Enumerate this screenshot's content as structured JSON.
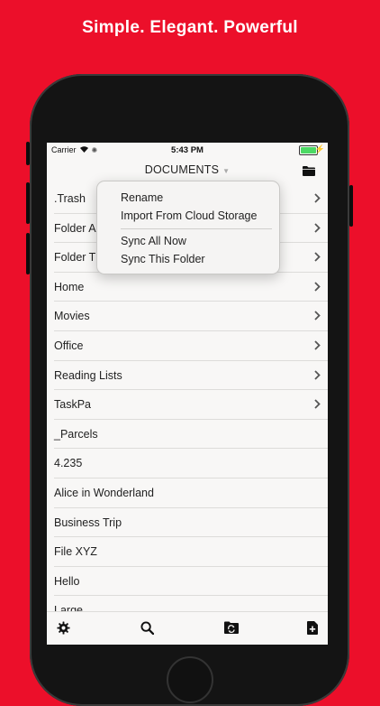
{
  "headline": "Simple. Elegant. Powerful",
  "status": {
    "carrier": "Carrier",
    "time": "5:43 PM",
    "battery_color": "#4cd964"
  },
  "nav": {
    "title": "DOCUMENTS"
  },
  "popup": {
    "items": [
      "Rename",
      "Import From Cloud Storage",
      "Sync All Now",
      "Sync This Folder"
    ]
  },
  "list": [
    {
      "label": ".Trash",
      "folder": true
    },
    {
      "label": "Folder A",
      "folder": true
    },
    {
      "label": "Folder T",
      "folder": true
    },
    {
      "label": "Home",
      "folder": true
    },
    {
      "label": "Movies",
      "folder": true
    },
    {
      "label": "Office",
      "folder": true
    },
    {
      "label": "Reading Lists",
      "folder": true
    },
    {
      "label": "TaskPa",
      "folder": true
    },
    {
      "label": "_Parcels",
      "folder": false
    },
    {
      "label": "4.235",
      "folder": false
    },
    {
      "label": "Alice in Wonderland",
      "folder": false
    },
    {
      "label": "Business Trip",
      "folder": false
    },
    {
      "label": "File XYZ",
      "folder": false
    },
    {
      "label": "Hello",
      "folder": false
    },
    {
      "label": "Large",
      "folder": false
    }
  ],
  "toolbar": {
    "icons": [
      "gear-icon",
      "search-icon",
      "sync-folder-icon",
      "new-file-icon"
    ]
  },
  "colors": {
    "background": "#ec0f2a",
    "accent": "#222222"
  }
}
